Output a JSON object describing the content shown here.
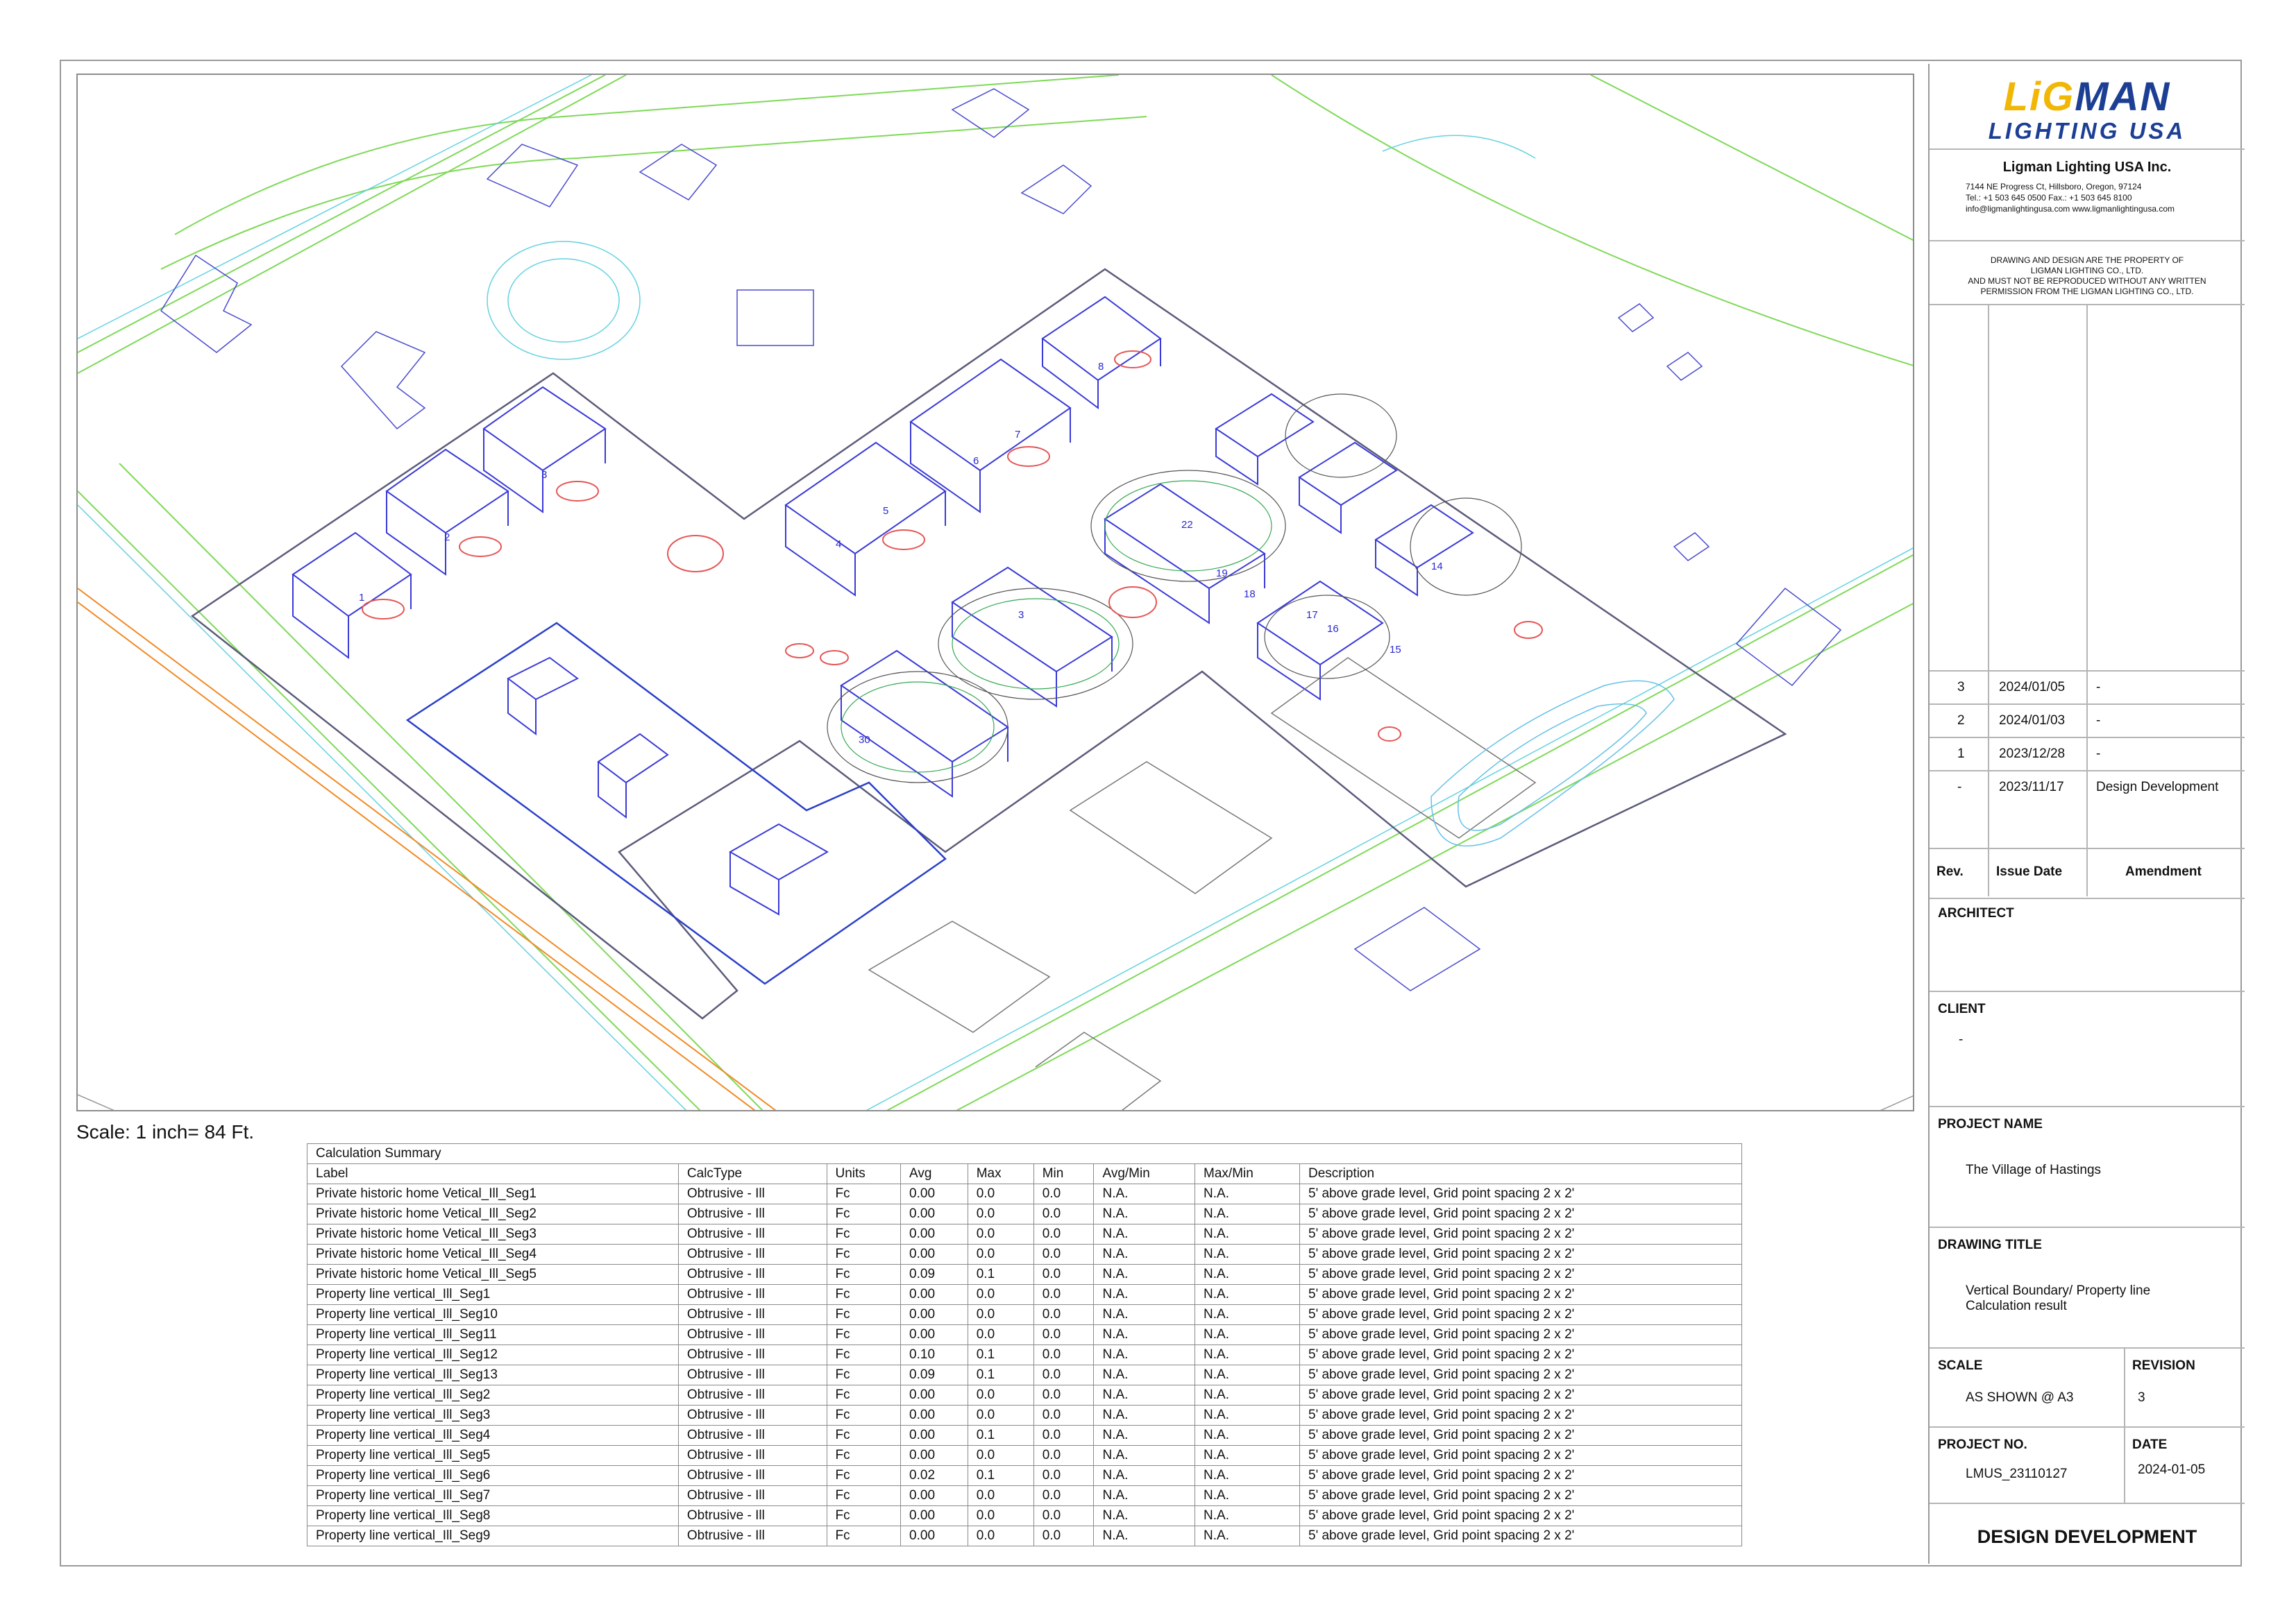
{
  "scale_note": "Scale: 1 inch= 84 Ft.",
  "site_labels": [
    "1",
    "2",
    "3",
    "4",
    "5",
    "6",
    "7",
    "8",
    "22",
    "19",
    "18",
    "17",
    "16",
    "15",
    "14",
    "30",
    "3"
  ],
  "calc": {
    "caption": "Calculation Summary",
    "headers": [
      "Label",
      "CalcType",
      "Units",
      "Avg",
      "Max",
      "Min",
      "Avg/Min",
      "Max/Min",
      "Description"
    ],
    "rows": [
      [
        "Private historic home Vetical_Ill_Seg1",
        "Obtrusive - Ill",
        "Fc",
        "0.00",
        "0.0",
        "0.0",
        "N.A.",
        "N.A.",
        "5' above grade level, Grid point spacing 2 x 2'"
      ],
      [
        "Private historic home Vetical_Ill_Seg2",
        "Obtrusive - Ill",
        "Fc",
        "0.00",
        "0.0",
        "0.0",
        "N.A.",
        "N.A.",
        "5' above grade level, Grid point spacing 2 x 2'"
      ],
      [
        "Private historic home Vetical_Ill_Seg3",
        "Obtrusive - Ill",
        "Fc",
        "0.00",
        "0.0",
        "0.0",
        "N.A.",
        "N.A.",
        "5' above grade level, Grid point spacing 2 x 2'"
      ],
      [
        "Private historic home Vetical_Ill_Seg4",
        "Obtrusive - Ill",
        "Fc",
        "0.00",
        "0.0",
        "0.0",
        "N.A.",
        "N.A.",
        "5' above grade level, Grid point spacing 2 x 2'"
      ],
      [
        "Private historic home Vetical_Ill_Seg5",
        "Obtrusive - Ill",
        "Fc",
        "0.09",
        "0.1",
        "0.0",
        "N.A.",
        "N.A.",
        "5' above grade level, Grid point spacing 2 x 2'"
      ],
      [
        "Property line vertical_Ill_Seg1",
        "Obtrusive - Ill",
        "Fc",
        "0.00",
        "0.0",
        "0.0",
        "N.A.",
        "N.A.",
        "5' above grade level, Grid point spacing 2 x 2'"
      ],
      [
        "Property line vertical_Ill_Seg10",
        "Obtrusive - Ill",
        "Fc",
        "0.00",
        "0.0",
        "0.0",
        "N.A.",
        "N.A.",
        "5' above grade level, Grid point spacing 2 x 2'"
      ],
      [
        "Property line vertical_Ill_Seg11",
        "Obtrusive - Ill",
        "Fc",
        "0.00",
        "0.0",
        "0.0",
        "N.A.",
        "N.A.",
        "5' above grade level, Grid point spacing 2 x 2'"
      ],
      [
        "Property line vertical_Ill_Seg12",
        "Obtrusive - Ill",
        "Fc",
        "0.10",
        "0.1",
        "0.0",
        "N.A.",
        "N.A.",
        "5' above grade level, Grid point spacing 2 x 2'"
      ],
      [
        "Property line vertical_Ill_Seg13",
        "Obtrusive - Ill",
        "Fc",
        "0.09",
        "0.1",
        "0.0",
        "N.A.",
        "N.A.",
        "5' above grade level, Grid point spacing 2 x 2'"
      ],
      [
        "Property line vertical_Ill_Seg2",
        "Obtrusive - Ill",
        "Fc",
        "0.00",
        "0.0",
        "0.0",
        "N.A.",
        "N.A.",
        "5' above grade level, Grid point spacing 2 x 2'"
      ],
      [
        "Property line vertical_Ill_Seg3",
        "Obtrusive - Ill",
        "Fc",
        "0.00",
        "0.0",
        "0.0",
        "N.A.",
        "N.A.",
        "5' above grade level, Grid point spacing 2 x 2'"
      ],
      [
        "Property line vertical_Ill_Seg4",
        "Obtrusive - Ill",
        "Fc",
        "0.00",
        "0.1",
        "0.0",
        "N.A.",
        "N.A.",
        "5' above grade level, Grid point spacing 2 x 2'"
      ],
      [
        "Property line vertical_Ill_Seg5",
        "Obtrusive - Ill",
        "Fc",
        "0.00",
        "0.0",
        "0.0",
        "N.A.",
        "N.A.",
        "5' above grade level, Grid point spacing 2 x 2'"
      ],
      [
        "Property line vertical_Ill_Seg6",
        "Obtrusive - Ill",
        "Fc",
        "0.02",
        "0.1",
        "0.0",
        "N.A.",
        "N.A.",
        "5' above grade level, Grid point spacing 2 x 2'"
      ],
      [
        "Property line vertical_Ill_Seg7",
        "Obtrusive - Ill",
        "Fc",
        "0.00",
        "0.0",
        "0.0",
        "N.A.",
        "N.A.",
        "5' above grade level, Grid point spacing 2 x 2'"
      ],
      [
        "Property line vertical_Ill_Seg8",
        "Obtrusive - Ill",
        "Fc",
        "0.00",
        "0.0",
        "0.0",
        "N.A.",
        "N.A.",
        "5' above grade level, Grid point spacing 2 x 2'"
      ],
      [
        "Property line vertical_Ill_Seg9",
        "Obtrusive - Ill",
        "Fc",
        "0.00",
        "0.0",
        "0.0",
        "N.A.",
        "N.A.",
        "5' above grade level, Grid point spacing 2 x 2'"
      ]
    ]
  },
  "titleblock": {
    "logo_top_a": "LiG",
    "logo_top_b": "MAN",
    "logo_bottom": "LIGHTING  USA",
    "company": "Ligman Lighting USA Inc.",
    "address": "7144 NE Progress Ct, Hillsboro, Oregon, 97124",
    "phone": "Tel.: +1 503 645 0500 Fax.: +1 503 645 8100",
    "contact": "info@ligmanlightingusa.com www.ligmanlightingusa.com",
    "notice": [
      "DRAWING AND DESIGN ARE THE PROPERTY OF",
      "LIGMAN LIGHTING CO., LTD.",
      "AND MUST NOT BE REPRODUCED WITHOUT ANY WRITTEN",
      "PERMISSION FROM THE LIGMAN LIGHTING CO., LTD."
    ],
    "revisions": [
      {
        "rev": "3",
        "date": "2024/01/05",
        "amend": "-"
      },
      {
        "rev": "2",
        "date": "2024/01/03",
        "amend": "-"
      },
      {
        "rev": "1",
        "date": "2023/12/28",
        "amend": "-"
      },
      {
        "rev": "-",
        "date": "2023/11/17",
        "amend": "Design Development"
      }
    ],
    "rev_headers": {
      "rev": "Rev.",
      "date": "Issue Date",
      "amend": "Amendment"
    },
    "architect_label": "ARCHITECT",
    "client_label": "CLIENT",
    "client_value": "-",
    "project_name_label": "PROJECT NAME",
    "project_name": "The Village of Hastings",
    "drawing_title_label": "DRAWING TITLE",
    "drawing_title_1": "Vertical Boundary/ Property line",
    "drawing_title_2": "Calculation result",
    "scale_label": "SCALE",
    "scale_value": "AS SHOWN @ A3",
    "revision_label": "REVISION",
    "revision_value": "3",
    "project_no_label": "PROJECT NO.",
    "project_no": "LMUS_23110127",
    "date_label": "DATE",
    "date_value": "2024-01-05",
    "stage": "DESIGN DEVELOPMENT"
  }
}
